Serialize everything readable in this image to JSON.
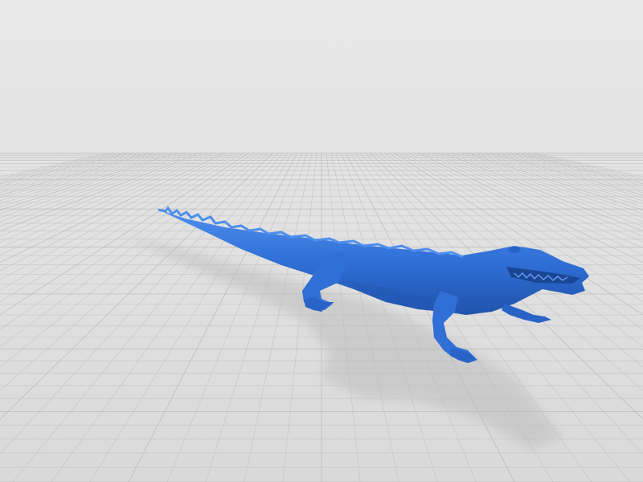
{
  "viewport": {
    "background_top": "#e8e8e8",
    "background_bottom": "#dadada",
    "grid_color": "#c2c2c2",
    "grid_major_color": "#b0b0b0",
    "shadow_color": "#cfcfcf"
  },
  "model": {
    "subject": "alligator",
    "color": "#2f6fd6",
    "color_dark": "#1f52a8",
    "color_light": "#4f8fee"
  }
}
